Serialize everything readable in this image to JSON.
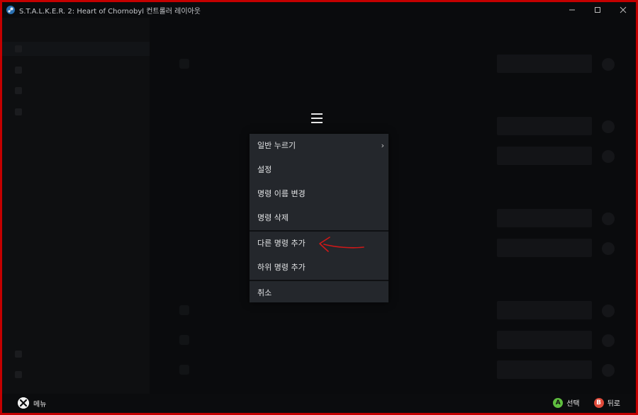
{
  "window": {
    "title": "S.T.A.L.K.E.R. 2: Heart of Chornobyl 컨트롤러 레이아웃"
  },
  "menu": {
    "items": [
      {
        "label": "일반 누르기",
        "submenu": true
      },
      {
        "label": "설정"
      },
      {
        "label": "명령 이름 변경"
      },
      {
        "label": "명령 삭제"
      },
      {
        "label": "다른 명령 추가"
      },
      {
        "label": "하위 명령 추가"
      },
      {
        "label": "취소"
      }
    ],
    "chevron": "›"
  },
  "footer": {
    "menu_label": "메뉴",
    "a_glyph": "A",
    "select_label": "선택",
    "b_glyph": "B",
    "back_label": "뒤로"
  },
  "colors": {
    "frame": "#c40000",
    "menu_bg": "#24272c",
    "annotation": "#d01818",
    "button_a": "#5fbf3f",
    "button_b": "#e04a3a"
  }
}
